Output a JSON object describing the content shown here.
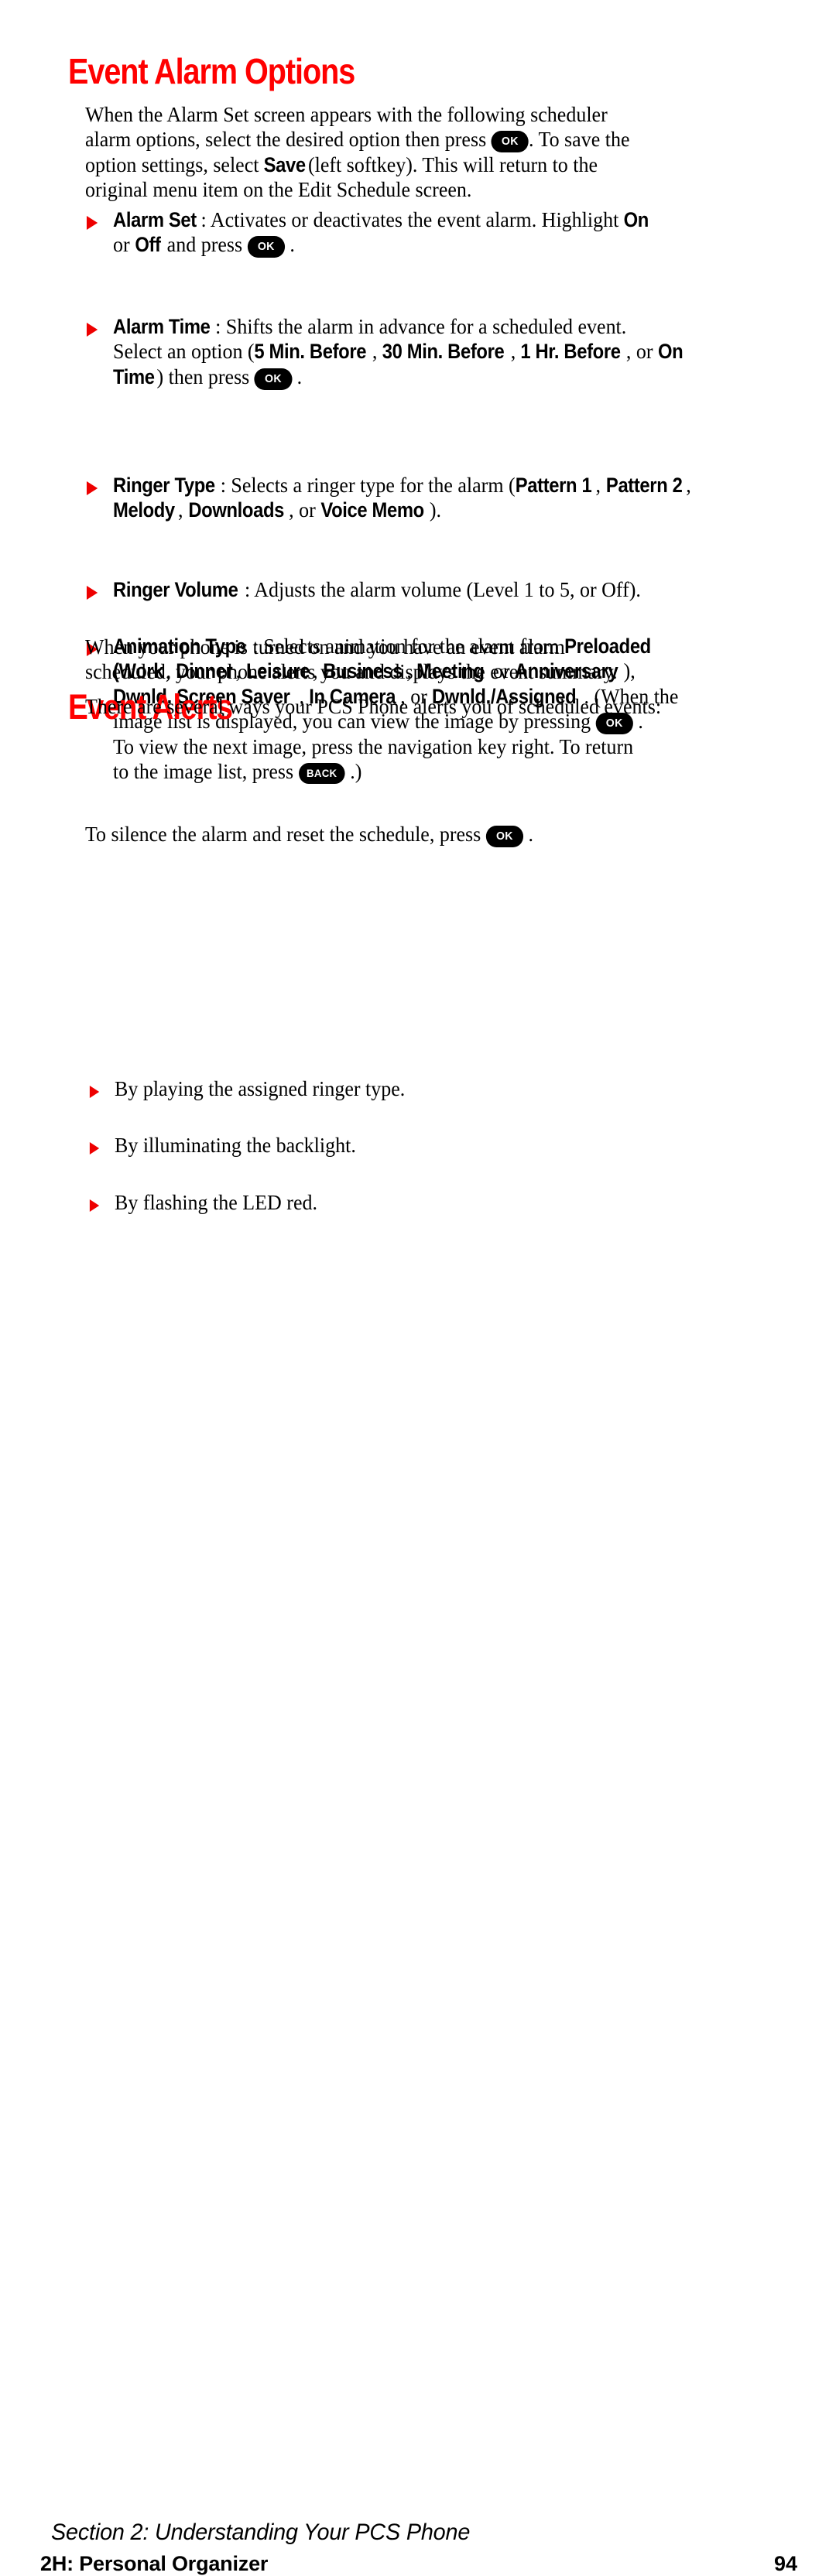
{
  "page": {
    "background_color": "#ffffff",
    "accent_color": "#ff0000",
    "text_color": "#000000"
  },
  "sections": {
    "event_alarm_options": {
      "heading": "Event Alarm Options",
      "intro": {
        "line1_a": "When the Alarm Set screen appears with the following scheduler",
        "line2_a": "alarm options, select the desired option then press",
        "line2_key": "OK",
        "line2_b": ". To save the",
        "line3_a": "option settings, select",
        "line3_bold": "Save",
        "line3_b": "(left softkey). This will return to the",
        "line4_a": "original menu item on the Edit Schedule screen."
      },
      "bullets": [
        {
          "term": "Alarm Set",
          "line1_after_term": ": Activates or deactivates the event alarm. Highlight",
          "line1_bold_end": "On",
          "line2_a": "or",
          "line2_bold": "Off",
          "line2_b": "and press",
          "line2_key": "OK",
          "line2_c": "."
        },
        {
          "term": "Alarm Time",
          "line1_after_term": ": Shifts the alarm in advance for a scheduled event.",
          "line2_a": "Select an option (",
          "line2_opt1": "5 Min. Before",
          "line2_sep1": ",",
          "line2_opt2": "30 Min. Before",
          "line2_sep2": ",",
          "line2_opt3": "1 Hr. Before",
          "line2_sep3": ", or",
          "line2_opt4": "On",
          "line3_opt4b": "Time",
          "line3_a": ") then press",
          "line3_key": "OK",
          "line3_b": "."
        },
        {
          "term": "Ringer Type",
          "line1_after_term": ": Selects a ringer type for the alarm (",
          "line1_opt1": "Pattern 1",
          "line1_sep1": ",",
          "line1_opt2": "Pattern 2",
          "line1_sep2": ",",
          "line2_opt3": "Melody",
          "line2_sep3": ",",
          "line2_opt4": "Downloads",
          "line2_sep4": ", or",
          "line2_opt5": "Voice Memo",
          "line2_end": ")."
        },
        {
          "term": "Ringer Volume",
          "line1_after_term": ": Adjusts the alarm volume (Level 1 to 5, or Off)."
        },
        {
          "term": "Animation Type",
          "line1_after_term": ": Selects animation for the alarm from",
          "line1_bold_end": "Preloaded",
          "line2_open": "(",
          "line2_opt1": "Work",
          "line2_sep1": ",",
          "line2_opt2": "Dinner",
          "line2_sep2": ",",
          "line2_opt3": "Leisure",
          "line2_sep3": ",",
          "line2_opt4": "Business",
          "line2_sep4": ",",
          "line2_opt5": "Meeting",
          "line2_or": "or",
          "line2_opt6": "Anniversary",
          "line2_end": "),",
          "line3_opt7": "Dwnld. Screen Saver",
          "line3_sep5": ",",
          "line3_opt8": "In Camera",
          "line3_sep6": ", or",
          "line3_opt9": "Dwnld./Assigned",
          "line3_end": ". (When the",
          "line4_a": "image list is displayed, you can view the image by pressing",
          "line4_key": "OK",
          "line4_b": ".",
          "line5_a": "To view the next image, press the navigation key right. To return",
          "line6_a": "to the image list, press",
          "line6_key": "BACK",
          "line6_b": ".)"
        }
      ]
    },
    "event_alerts": {
      "heading": "Event Alerts",
      "paragraph1_line1": "When your phone is turned on and you have an event alarm",
      "paragraph1_line2": "scheduled, your phone alerts you and displays the event summary.",
      "paragraph2": "There are several ways your PCS Phone alerts you of scheduled events:",
      "bullets": [
        "By playing the assigned ringer type.",
        "By illuminating the backlight.",
        "By flashing the LED red."
      ],
      "closing_a": "To silence the alarm and reset the schedule, press",
      "closing_key": "OK",
      "closing_b": "."
    }
  },
  "footer": {
    "section_line": "Section 2: Understanding Your PCS Phone",
    "chapter": "2H: Personal Organizer",
    "page_number": "94"
  }
}
